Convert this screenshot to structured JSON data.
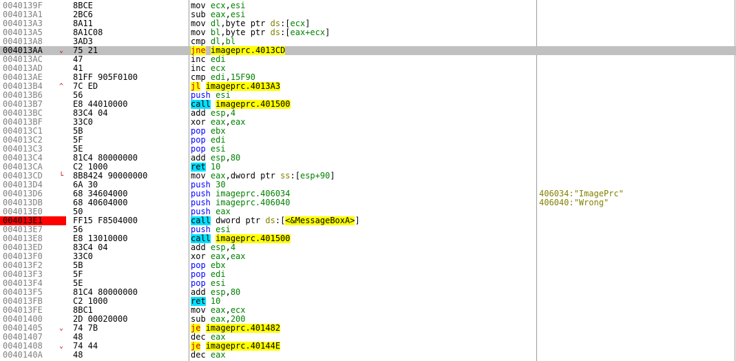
{
  "colors": {
    "selected_row": "#c0c0c0",
    "breakpoint": "#ff0000",
    "jump_highlight": "#ffff00",
    "call_highlight": "#00e0ff",
    "register": "#008000",
    "comment": "#808000"
  },
  "rows": [
    {
      "addr": "0040139F",
      "jmp": "",
      "bytes": "8BCE",
      "tokens": [
        [
          "mov ",
          "kw-mov"
        ],
        [
          "ecx",
          "reg"
        ],
        [
          ",",
          ""
        ],
        [
          "esi",
          "reg"
        ]
      ],
      "cmt": ""
    },
    {
      "addr": "004013A1",
      "jmp": "",
      "bytes": "2BC6",
      "tokens": [
        [
          "sub ",
          "kw-sub"
        ],
        [
          "eax",
          "reg"
        ],
        [
          ",",
          ""
        ],
        [
          "esi",
          "reg"
        ]
      ],
      "cmt": ""
    },
    {
      "addr": "004013A3",
      "jmp": "",
      "bytes": "8A11",
      "tokens": [
        [
          "mov ",
          "kw-mov"
        ],
        [
          "dl",
          "reg"
        ],
        [
          ",byte ptr ",
          ""
        ],
        [
          "ds",
          "seg"
        ],
        [
          ":[",
          ""
        ],
        [
          "ecx",
          "reg"
        ],
        [
          "]",
          ""
        ]
      ],
      "cmt": ""
    },
    {
      "addr": "004013A5",
      "jmp": "",
      "bytes": "8A1C08",
      "tokens": [
        [
          "mov ",
          "kw-mov"
        ],
        [
          "bl",
          "reg"
        ],
        [
          ",byte ptr ",
          ""
        ],
        [
          "ds",
          "seg"
        ],
        [
          ":[",
          ""
        ],
        [
          "eax+ecx",
          "reg"
        ],
        [
          "]",
          ""
        ]
      ],
      "cmt": ""
    },
    {
      "addr": "004013A8",
      "jmp": "",
      "bytes": "3AD3",
      "tokens": [
        [
          "cmp ",
          "kw-cmp"
        ],
        [
          "dl",
          "reg"
        ],
        [
          ",",
          ""
        ],
        [
          "bl",
          "reg"
        ]
      ],
      "cmt": ""
    },
    {
      "addr": "004013AA",
      "jmp": "⌄",
      "bytes": "75 21",
      "tokens": [
        [
          "jne",
          "kw-jcc"
        ],
        [
          " ",
          ""
        ],
        [
          "imageprc.4013CD",
          "tgt"
        ]
      ],
      "cmt": "",
      "selected": true
    },
    {
      "addr": "004013AC",
      "jmp": "",
      "bytes": "47",
      "tokens": [
        [
          "inc ",
          "kw-inc"
        ],
        [
          "edi",
          "reg"
        ]
      ],
      "cmt": ""
    },
    {
      "addr": "004013AD",
      "jmp": "",
      "bytes": "41",
      "tokens": [
        [
          "inc ",
          "kw-inc"
        ],
        [
          "ecx",
          "reg"
        ]
      ],
      "cmt": ""
    },
    {
      "addr": "004013AE",
      "jmp": "",
      "bytes": "81FF 905F0100",
      "tokens": [
        [
          "cmp ",
          "kw-cmp"
        ],
        [
          "edi",
          "reg"
        ],
        [
          ",",
          ""
        ],
        [
          "15F90",
          "num"
        ]
      ],
      "cmt": ""
    },
    {
      "addr": "004013B4",
      "jmp": "^",
      "bytes": "7C ED",
      "tokens": [
        [
          "jl",
          "kw-jcc"
        ],
        [
          " ",
          ""
        ],
        [
          "imageprc.4013A3",
          "tgt"
        ]
      ],
      "cmt": ""
    },
    {
      "addr": "004013B6",
      "jmp": "",
      "bytes": "56",
      "tokens": [
        [
          "push ",
          "kw-push"
        ],
        [
          "esi",
          "reg"
        ]
      ],
      "cmt": ""
    },
    {
      "addr": "004013B7",
      "jmp": "",
      "bytes": "E8 44010000",
      "tokens": [
        [
          "call",
          "kw-call"
        ],
        [
          " ",
          ""
        ],
        [
          "imageprc.401500",
          "tgt"
        ]
      ],
      "cmt": ""
    },
    {
      "addr": "004013BC",
      "jmp": "",
      "bytes": "83C4 04",
      "tokens": [
        [
          "add ",
          "kw-add"
        ],
        [
          "esp",
          "reg"
        ],
        [
          ",",
          ""
        ],
        [
          "4",
          "num"
        ]
      ],
      "cmt": ""
    },
    {
      "addr": "004013BF",
      "jmp": "",
      "bytes": "33C0",
      "tokens": [
        [
          "xor ",
          "kw-xor"
        ],
        [
          "eax",
          "reg"
        ],
        [
          ",",
          ""
        ],
        [
          "eax",
          "reg"
        ]
      ],
      "cmt": ""
    },
    {
      "addr": "004013C1",
      "jmp": "",
      "bytes": "5B",
      "tokens": [
        [
          "pop ",
          "kw-pop"
        ],
        [
          "ebx",
          "reg"
        ]
      ],
      "cmt": ""
    },
    {
      "addr": "004013C2",
      "jmp": "",
      "bytes": "5F",
      "tokens": [
        [
          "pop ",
          "kw-pop"
        ],
        [
          "edi",
          "reg"
        ]
      ],
      "cmt": ""
    },
    {
      "addr": "004013C3",
      "jmp": "",
      "bytes": "5E",
      "tokens": [
        [
          "pop ",
          "kw-pop"
        ],
        [
          "esi",
          "reg"
        ]
      ],
      "cmt": ""
    },
    {
      "addr": "004013C4",
      "jmp": "",
      "bytes": "81C4 80000000",
      "tokens": [
        [
          "add ",
          "kw-add"
        ],
        [
          "esp",
          "reg"
        ],
        [
          ",",
          ""
        ],
        [
          "80",
          "num"
        ]
      ],
      "cmt": ""
    },
    {
      "addr": "004013CA",
      "jmp": "",
      "bytes": "C2 1000",
      "tokens": [
        [
          "ret",
          "kw-ret"
        ],
        [
          " ",
          ""
        ],
        [
          "10",
          "num"
        ]
      ],
      "cmt": ""
    },
    {
      "addr": "004013CD",
      "jmp": "└",
      "bytes": "8B8424 90000000",
      "tokens": [
        [
          "mov ",
          "kw-mov"
        ],
        [
          "eax",
          "reg"
        ],
        [
          ",dword ptr ",
          ""
        ],
        [
          "ss",
          "seg"
        ],
        [
          ":[",
          ""
        ],
        [
          "esp+90",
          "reg"
        ],
        [
          "]",
          ""
        ]
      ],
      "cmt": ""
    },
    {
      "addr": "004013D4",
      "jmp": "",
      "bytes": "6A 30",
      "tokens": [
        [
          "push ",
          "kw-push"
        ],
        [
          "30",
          "num"
        ]
      ],
      "cmt": ""
    },
    {
      "addr": "004013D6",
      "jmp": "",
      "bytes": "68 34604000",
      "tokens": [
        [
          "push ",
          "kw-push"
        ],
        [
          "imageprc.406034",
          "num"
        ]
      ],
      "cmt": "406034:\"ImagePrc\""
    },
    {
      "addr": "004013DB",
      "jmp": "",
      "bytes": "68 40604000",
      "tokens": [
        [
          "push ",
          "kw-push"
        ],
        [
          "imageprc.406040",
          "num"
        ]
      ],
      "cmt": "406040:\"Wrong\""
    },
    {
      "addr": "004013E0",
      "jmp": "",
      "bytes": "50",
      "tokens": [
        [
          "push ",
          "kw-push"
        ],
        [
          "eax",
          "reg"
        ]
      ],
      "cmt": ""
    },
    {
      "addr": "004013E1",
      "jmp": "",
      "bytes": "FF15 F8504000",
      "tokens": [
        [
          "call",
          "kw-call"
        ],
        [
          " dword ptr ",
          ""
        ],
        [
          "ds",
          "seg"
        ],
        [
          ":[",
          ""
        ],
        [
          "<&MessageBoxA>",
          "api"
        ],
        [
          "]",
          ""
        ]
      ],
      "cmt": "",
      "breakpoint": true
    },
    {
      "addr": "004013E7",
      "jmp": "",
      "bytes": "56",
      "tokens": [
        [
          "push ",
          "kw-push"
        ],
        [
          "esi",
          "reg"
        ]
      ],
      "cmt": ""
    },
    {
      "addr": "004013E8",
      "jmp": "",
      "bytes": "E8 13010000",
      "tokens": [
        [
          "call",
          "kw-call"
        ],
        [
          " ",
          ""
        ],
        [
          "imageprc.401500",
          "tgt"
        ]
      ],
      "cmt": ""
    },
    {
      "addr": "004013ED",
      "jmp": "",
      "bytes": "83C4 04",
      "tokens": [
        [
          "add ",
          "kw-add"
        ],
        [
          "esp",
          "reg"
        ],
        [
          ",",
          ""
        ],
        [
          "4",
          "num"
        ]
      ],
      "cmt": ""
    },
    {
      "addr": "004013F0",
      "jmp": "",
      "bytes": "33C0",
      "tokens": [
        [
          "xor ",
          "kw-xor"
        ],
        [
          "eax",
          "reg"
        ],
        [
          ",",
          ""
        ],
        [
          "eax",
          "reg"
        ]
      ],
      "cmt": ""
    },
    {
      "addr": "004013F2",
      "jmp": "",
      "bytes": "5B",
      "tokens": [
        [
          "pop ",
          "kw-pop"
        ],
        [
          "ebx",
          "reg"
        ]
      ],
      "cmt": ""
    },
    {
      "addr": "004013F3",
      "jmp": "",
      "bytes": "5F",
      "tokens": [
        [
          "pop ",
          "kw-pop"
        ],
        [
          "edi",
          "reg"
        ]
      ],
      "cmt": ""
    },
    {
      "addr": "004013F4",
      "jmp": "",
      "bytes": "5E",
      "tokens": [
        [
          "pop ",
          "kw-pop"
        ],
        [
          "esi",
          "reg"
        ]
      ],
      "cmt": ""
    },
    {
      "addr": "004013F5",
      "jmp": "",
      "bytes": "81C4 80000000",
      "tokens": [
        [
          "add ",
          "kw-add"
        ],
        [
          "esp",
          "reg"
        ],
        [
          ",",
          ""
        ],
        [
          "80",
          "num"
        ]
      ],
      "cmt": ""
    },
    {
      "addr": "004013FB",
      "jmp": "",
      "bytes": "C2 1000",
      "tokens": [
        [
          "ret",
          "kw-ret"
        ],
        [
          " ",
          ""
        ],
        [
          "10",
          "num"
        ]
      ],
      "cmt": ""
    },
    {
      "addr": "004013FE",
      "jmp": "",
      "bytes": "8BC1",
      "tokens": [
        [
          "mov ",
          "kw-mov"
        ],
        [
          "eax",
          "reg"
        ],
        [
          ",",
          ""
        ],
        [
          "ecx",
          "reg"
        ]
      ],
      "cmt": ""
    },
    {
      "addr": "00401400",
      "jmp": "",
      "bytes": "2D 00020000",
      "tokens": [
        [
          "sub ",
          "kw-sub"
        ],
        [
          "eax",
          "reg"
        ],
        [
          ",",
          ""
        ],
        [
          "200",
          "num"
        ]
      ],
      "cmt": ""
    },
    {
      "addr": "00401405",
      "jmp": "⌄",
      "bytes": "74 7B",
      "tokens": [
        [
          "je",
          "kw-jcc"
        ],
        [
          " ",
          ""
        ],
        [
          "imageprc.401482",
          "tgt"
        ]
      ],
      "cmt": ""
    },
    {
      "addr": "00401407",
      "jmp": "",
      "bytes": "48",
      "tokens": [
        [
          "dec ",
          "kw-dec"
        ],
        [
          "eax",
          "reg"
        ]
      ],
      "cmt": ""
    },
    {
      "addr": "00401408",
      "jmp": "⌄",
      "bytes": "74 44",
      "tokens": [
        [
          "je",
          "kw-jcc"
        ],
        [
          " ",
          ""
        ],
        [
          "imageprc.40144E",
          "tgt"
        ]
      ],
      "cmt": ""
    },
    {
      "addr": "0040140A",
      "jmp": "",
      "bytes": "48",
      "tokens": [
        [
          "dec ",
          "kw-dec"
        ],
        [
          "eax",
          "reg"
        ]
      ],
      "cmt": ""
    }
  ]
}
